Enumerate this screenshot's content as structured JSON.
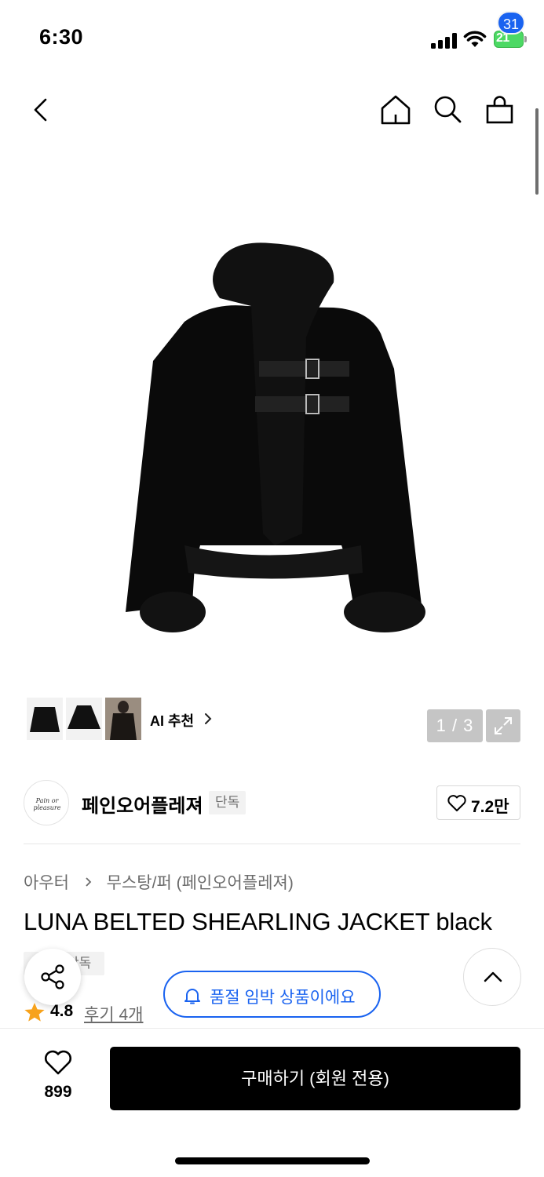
{
  "status_bar": {
    "time": "6:30",
    "battery_level": "21",
    "battery_color": "#4cd964"
  },
  "header": {
    "icons": [
      "back-icon",
      "home-icon",
      "search-icon",
      "cart-icon"
    ],
    "cart_count": "31"
  },
  "gallery": {
    "ai_recommend_label": "AI 추천",
    "page_counter": "1 / 3",
    "icons": [
      "chevron-right-icon",
      "expand-icon"
    ]
  },
  "brand": {
    "logo_text": "Pain or pleasure",
    "name": "페인오어플레져",
    "tag": "단독",
    "likes": "7.2만"
  },
  "product": {
    "breadcrumb": [
      "아우터",
      "무스탕/퍼 (페인오어플레져)"
    ],
    "title": "LUNA BELTED SHEARLING JACKET black",
    "tag": "단독",
    "rating": "4.8",
    "review_link": "후기 4개"
  },
  "notice": {
    "soldout_text": "품절 임박 상품이에요"
  },
  "bottom_bar": {
    "wish_count": "899",
    "buy_label": "구매하기 (회원 전용)"
  },
  "colors": {
    "accent_blue": "#1a63f0",
    "star": "#f7a21b",
    "buy_button": "#000000"
  }
}
